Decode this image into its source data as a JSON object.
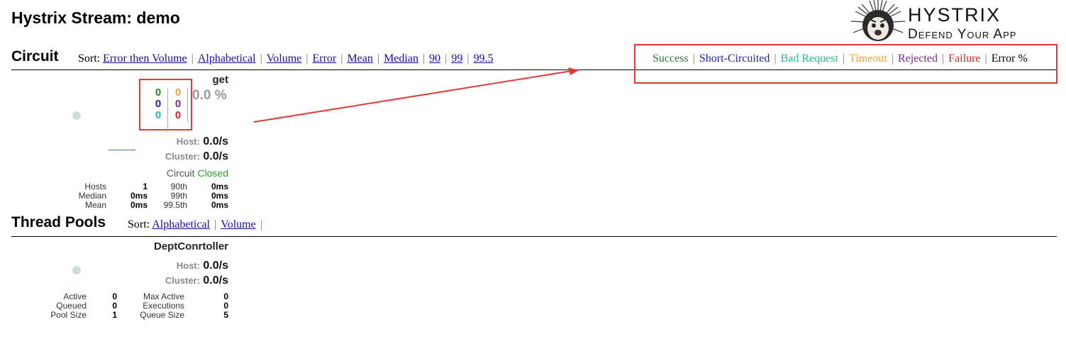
{
  "page": {
    "title": "Hystrix Stream: demo"
  },
  "logo": {
    "line1": "HYSTRIX",
    "line2": "Defend Your App"
  },
  "circuit_section": {
    "title": "Circuit",
    "sort_label": "Sort:",
    "sort_links": [
      "Error then Volume",
      "Alphabetical",
      "Volume",
      "Error",
      "Mean",
      "Median",
      "90",
      "99",
      "99.5"
    ],
    "legend": [
      {
        "label": "Success",
        "color": "#2e7d32"
      },
      {
        "label": "Short-Circuited",
        "color": "#1a23b8"
      },
      {
        "label": "Bad Request",
        "color": "#26b99a"
      },
      {
        "label": "Timeout",
        "color": "#f0a030"
      },
      {
        "label": "Rejected",
        "color": "#7b2a8b"
      },
      {
        "label": "Failure",
        "color": "#e02020"
      },
      {
        "label": "Error %",
        "color": "#000000"
      }
    ]
  },
  "circuit_card": {
    "name": "get",
    "counts": {
      "success": "0",
      "short_circuited": "0",
      "bad_request": "0",
      "timeout": "0",
      "rejected": "0",
      "failure": "0"
    },
    "error_percent": "0.0 %",
    "host_label": "Host:",
    "host_rate": "0.0/s",
    "cluster_label": "Cluster:",
    "cluster_rate": "0.0/s",
    "circuit_label": "Circuit",
    "circuit_state": "Closed",
    "stats": [
      {
        "l1": "Hosts",
        "v1": "1",
        "l2": "90th",
        "v2": "0ms"
      },
      {
        "l1": "Median",
        "v1": "0ms",
        "l2": "99th",
        "v2": "0ms"
      },
      {
        "l1": "Mean",
        "v1": "0ms",
        "l2": "99.5th",
        "v2": "0ms"
      }
    ]
  },
  "thread_section": {
    "title": "Thread Pools",
    "sort_label": "Sort:",
    "sort_links": [
      "Alphabetical",
      "Volume"
    ]
  },
  "thread_card": {
    "name": "DeptConrtoller",
    "host_label": "Host:",
    "host_rate": "0.0/s",
    "cluster_label": "Cluster:",
    "cluster_rate": "0.0/s",
    "stats": [
      {
        "l1": "Active",
        "v1": "0",
        "l2": "Max Active",
        "v2": "0"
      },
      {
        "l1": "Queued",
        "v1": "0",
        "l2": "Executions",
        "v2": "0"
      },
      {
        "l1": "Pool Size",
        "v1": "1",
        "l2": "Queue Size",
        "v2": "5"
      }
    ]
  },
  "colors": {
    "success": "#2e7d32",
    "short_circuited": "#1a23b8",
    "bad_request": "#26b99a",
    "timeout": "#f0a030",
    "rejected": "#7b2a8b",
    "failure": "#e02020",
    "closed": "#2ea02e",
    "annotation": "#e53935"
  }
}
